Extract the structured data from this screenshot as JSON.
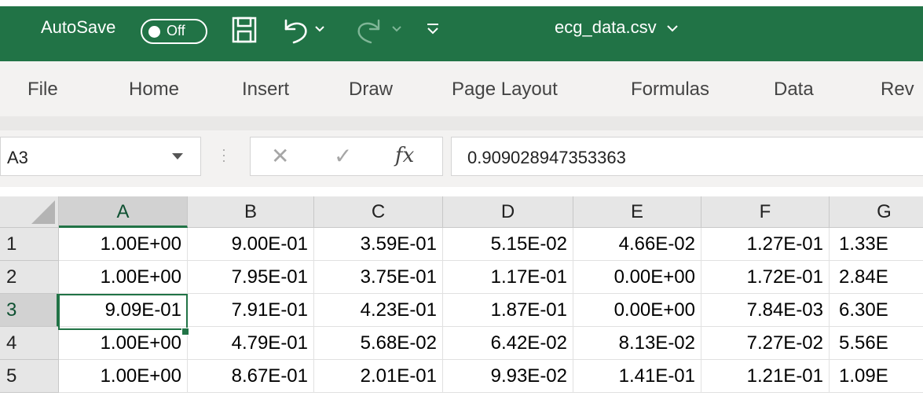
{
  "titlebar": {
    "autosave_label": "AutoSave",
    "autosave_state": "Off",
    "doc_title": "ecg_data.csv",
    "icons": [
      "save-icon",
      "undo-icon",
      "redo-icon",
      "customize-qat-icon"
    ],
    "accent": "#217346"
  },
  "ribbon": {
    "tabs": [
      "File",
      "Home",
      "Insert",
      "Draw",
      "Page Layout",
      "Formulas",
      "Data",
      "Rev"
    ]
  },
  "formula_bar": {
    "name_box": "A3",
    "formula": "0.909028947353363",
    "fx_label": "fx"
  },
  "sheet": {
    "columns": [
      "A",
      "B",
      "C",
      "D",
      "E",
      "F",
      "G"
    ],
    "rows": [
      {
        "label": "1",
        "cells": [
          "1.00E+00",
          "9.00E-01",
          "3.59E-01",
          "5.15E-02",
          "4.66E-02",
          "1.27E-01",
          "1.33E"
        ]
      },
      {
        "label": "2",
        "cells": [
          "1.00E+00",
          "7.95E-01",
          "3.75E-01",
          "1.17E-01",
          "0.00E+00",
          "1.72E-01",
          "2.84E"
        ]
      },
      {
        "label": "3",
        "cells": [
          "9.09E-01",
          "7.91E-01",
          "4.23E-01",
          "1.87E-01",
          "0.00E+00",
          "7.84E-03",
          "6.30E"
        ]
      },
      {
        "label": "4",
        "cells": [
          "1.00E+00",
          "4.79E-01",
          "5.68E-02",
          "6.42E-02",
          "8.13E-02",
          "7.27E-02",
          "5.56E"
        ]
      },
      {
        "label": "5",
        "cells": [
          "1.00E+00",
          "8.67E-01",
          "2.01E-01",
          "9.93E-02",
          "1.41E-01",
          "1.21E-01",
          "1.09E"
        ]
      }
    ],
    "active_cell": "A3"
  }
}
